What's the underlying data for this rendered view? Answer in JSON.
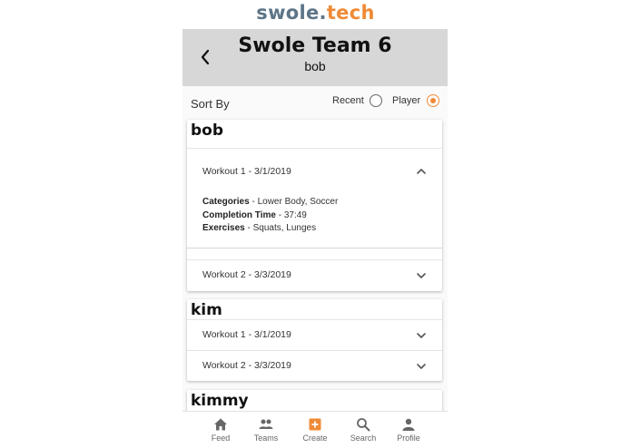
{
  "brand": {
    "part1": "swole.",
    "part2": "tech"
  },
  "header": {
    "title": "Swole Team 6",
    "subtitle": "bob"
  },
  "sort": {
    "label": "Sort By",
    "options": [
      {
        "label": "Recent",
        "selected": false
      },
      {
        "label": "Player",
        "selected": true
      }
    ]
  },
  "players": [
    {
      "name": "bob",
      "workouts": [
        {
          "label": "Workout 1 - 3/1/2019",
          "expanded": true,
          "details": {
            "categories_label": "Categories",
            "categories_value": " - Lower Body, Soccer",
            "time_label": "Completion Time",
            "time_value": " - 37:49",
            "exercises_label": "Exercises",
            "exercises_value": " - Squats, Lunges"
          }
        },
        {
          "label": "Workout 2 - 3/3/2019",
          "expanded": false
        }
      ]
    },
    {
      "name": "kim",
      "workouts": [
        {
          "label": "Workout 1 - 3/1/2019",
          "expanded": false
        },
        {
          "label": "Workout 2 - 3/3/2019",
          "expanded": false
        }
      ]
    },
    {
      "name": "kimmy",
      "workouts": []
    }
  ],
  "nav": [
    {
      "label": "Feed",
      "icon": "home-icon",
      "active": false
    },
    {
      "label": "Teams",
      "icon": "people-icon",
      "active": false
    },
    {
      "label": "Create",
      "icon": "add-box-icon",
      "active": true
    },
    {
      "label": "Search",
      "icon": "search-icon",
      "active": false
    },
    {
      "label": "Profile",
      "icon": "person-icon",
      "active": false
    }
  ],
  "colors": {
    "accent": "#f08a36",
    "brand_primary": "#5d7588",
    "header_bg": "#d7d7d7"
  }
}
